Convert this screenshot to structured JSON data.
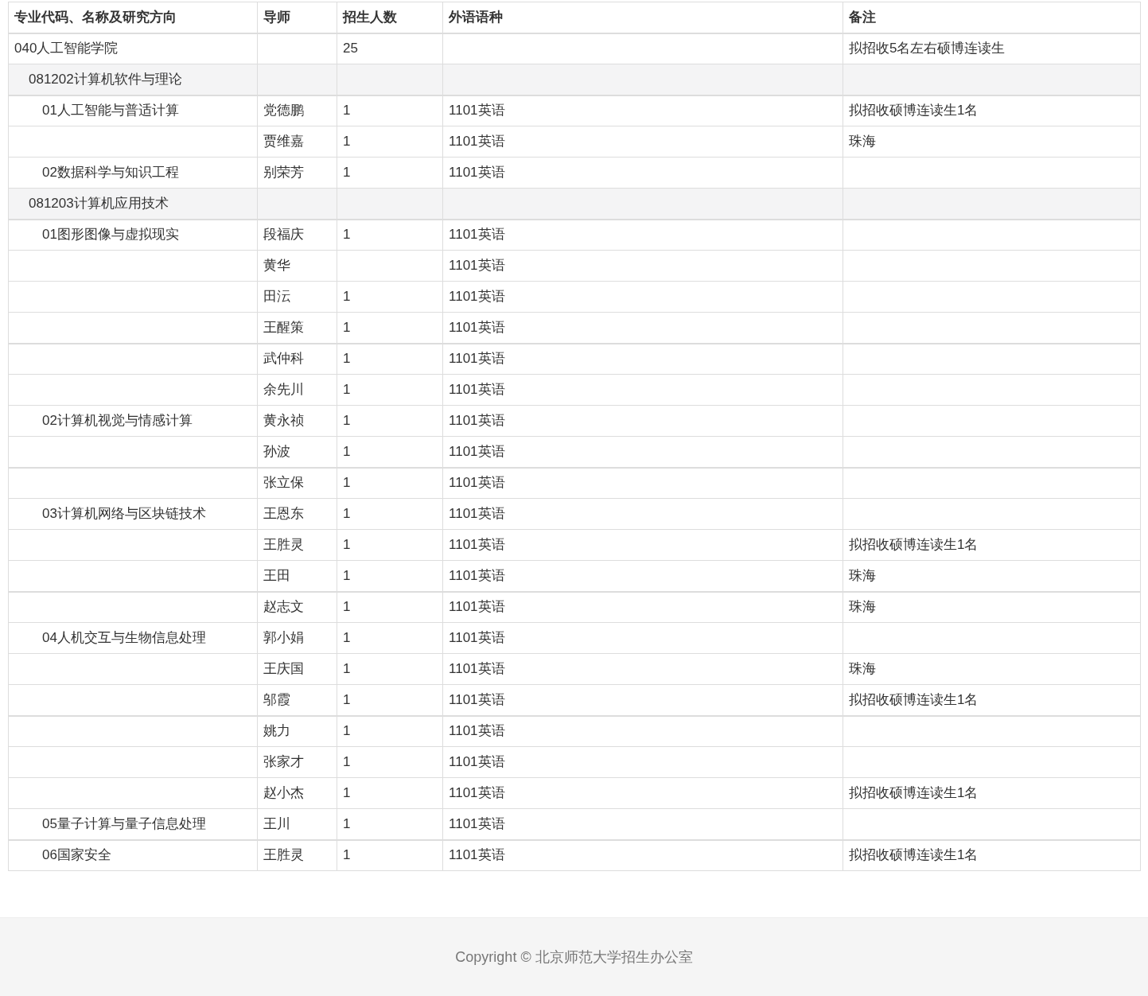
{
  "table": {
    "columns": [
      "专业代码、名称及研究方向",
      "导师",
      "招生人数",
      "外语语种",
      "备注"
    ],
    "rows": [
      {
        "kind": "college",
        "name": "040人工智能学院",
        "quota": "25",
        "note": "拟招收5名左右硕博连读生"
      },
      {
        "kind": "major",
        "name": "081202计算机软件与理论"
      },
      {
        "kind": "item",
        "name": "01人工智能与普适计算",
        "advisor": "党德鹏",
        "quota": "1",
        "language": "1101英语",
        "note": "拟招收硕博连读生1名"
      },
      {
        "kind": "item",
        "advisor": "贾维嘉",
        "quota": "1",
        "language": "1101英语",
        "note": "珠海"
      },
      {
        "kind": "item",
        "name": "02数据科学与知识工程",
        "advisor": "别荣芳",
        "quota": "1",
        "language": "1101英语"
      },
      {
        "kind": "major",
        "name": "081203计算机应用技术"
      },
      {
        "kind": "item",
        "name": "01图形图像与虚拟现实",
        "advisor": "段福庆",
        "quota": "1",
        "language": "1101英语"
      },
      {
        "kind": "item",
        "advisor": "黄华",
        "language": "1101英语"
      },
      {
        "kind": "item",
        "advisor": "田沄",
        "quota": "1",
        "language": "1101英语"
      },
      {
        "kind": "item",
        "advisor": "王醒策",
        "quota": "1",
        "language": "1101英语"
      },
      {
        "kind": "item",
        "advisor": "武仲科",
        "quota": "1",
        "language": "1101英语"
      },
      {
        "kind": "item",
        "advisor": "余先川",
        "quota": "1",
        "language": "1101英语"
      },
      {
        "kind": "item",
        "name": "02计算机视觉与情感计算",
        "advisor": "黄永祯",
        "quota": "1",
        "language": "1101英语"
      },
      {
        "kind": "item",
        "advisor": "孙波",
        "quota": "1",
        "language": "1101英语"
      },
      {
        "kind": "item",
        "advisor": "张立保",
        "quota": "1",
        "language": "1101英语"
      },
      {
        "kind": "item",
        "name": "03计算机网络与区块链技术",
        "advisor": "王恩东",
        "quota": "1",
        "language": "1101英语"
      },
      {
        "kind": "item",
        "advisor": "王胜灵",
        "quota": "1",
        "language": "1101英语",
        "note": "拟招收硕博连读生1名"
      },
      {
        "kind": "item",
        "advisor": "王田",
        "quota": "1",
        "language": "1101英语",
        "note": "珠海"
      },
      {
        "kind": "item",
        "advisor": "赵志文",
        "quota": "1",
        "language": "1101英语",
        "note": "珠海"
      },
      {
        "kind": "item",
        "name": "04人机交互与生物信息处理",
        "advisor": "郭小娟",
        "quota": "1",
        "language": "1101英语"
      },
      {
        "kind": "item",
        "advisor": "王庆国",
        "quota": "1",
        "language": "1101英语",
        "note": "珠海"
      },
      {
        "kind": "item",
        "advisor": "邬霞",
        "quota": "1",
        "language": "1101英语",
        "note": "拟招收硕博连读生1名"
      },
      {
        "kind": "item",
        "advisor": "姚力",
        "quota": "1",
        "language": "1101英语"
      },
      {
        "kind": "item",
        "advisor": "张家才",
        "quota": "1",
        "language": "1101英语"
      },
      {
        "kind": "item",
        "advisor": "赵小杰",
        "quota": "1",
        "language": "1101英语",
        "note": "拟招收硕博连读生1名"
      },
      {
        "kind": "item",
        "name": "05量子计算与量子信息处理",
        "advisor": "王川",
        "quota": "1",
        "language": "1101英语"
      },
      {
        "kind": "item",
        "name": "06国家安全",
        "advisor": "王胜灵",
        "quota": "1",
        "language": "1101英语",
        "note": "拟招收硕博连读生1名"
      }
    ]
  },
  "footer": {
    "text": "Copyright © 北京师范大学招生办公室"
  }
}
